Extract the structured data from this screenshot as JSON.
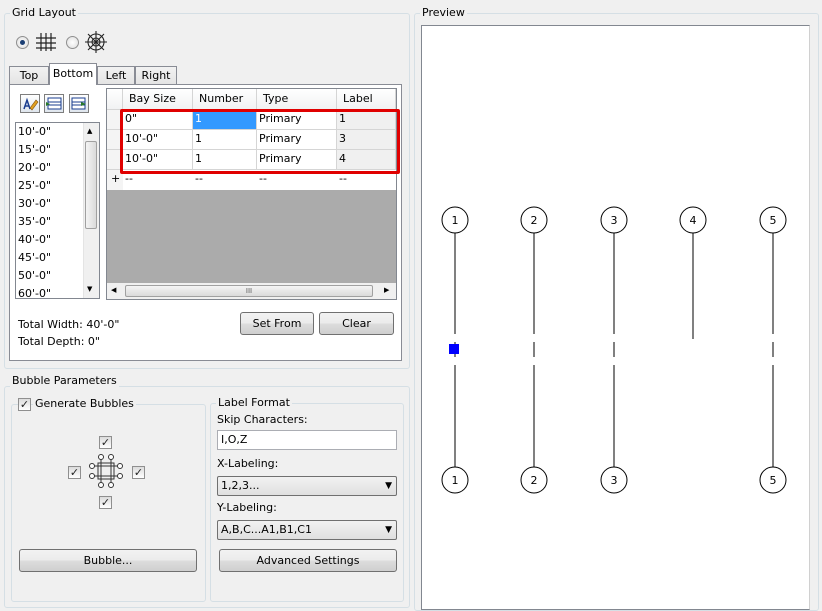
{
  "grid_layout": {
    "title": "Grid Layout",
    "mode_selected": "rectangular-grid",
    "tabs": [
      "Top",
      "Bottom",
      "Left",
      "Right"
    ],
    "active_tab": "Bottom",
    "sizes": [
      "10'-0\"",
      "15'-0\"",
      "20'-0\"",
      "25'-0\"",
      "30'-0\"",
      "35'-0\"",
      "40'-0\"",
      "45'-0\"",
      "50'-0\"",
      "60'-0\""
    ],
    "table": {
      "headers": [
        "Bay Size",
        "Number",
        "Type",
        "Label"
      ],
      "rows": [
        [
          "0\"",
          "1",
          "Primary",
          "1"
        ],
        [
          "10'-0\"",
          "1",
          "Primary",
          "3"
        ],
        [
          "10'-0\"",
          "1",
          "Primary",
          "4"
        ]
      ],
      "new_row_marker": "+",
      "new_row": [
        "--",
        "--",
        "--",
        "--"
      ],
      "scroll_grip": "III",
      "highlight_color": "#e00000"
    },
    "total_width": "Total Width: 40'-0\"",
    "total_depth": "Total Depth: 0\"",
    "set_from_label": "Set From",
    "clear_label": "Clear"
  },
  "bubble_parameters": {
    "title": "Bubble Parameters",
    "generate_bubbles_label": "Generate Bubbles",
    "generate_bubbles_checked": true,
    "sides_checked": {
      "top": true,
      "left": true,
      "right": true,
      "bottom": true
    },
    "bubble_button_label": "Bubble...",
    "label_format": {
      "title": "Label Format",
      "skip_characters_label": "Skip Characters:",
      "skip_characters_value": "I,O,Z",
      "x_labeling_label": "X-Labeling:",
      "x_labeling_value": "1,2,3...",
      "y_labeling_label": "Y-Labeling:",
      "y_labeling_value": "A,B,C...A1,B1,C1",
      "advanced_settings_label": "Advanced Settings"
    }
  },
  "preview": {
    "title": "Preview",
    "top_bubbles": [
      "1",
      "2",
      "3",
      "4",
      "5"
    ],
    "bottom_bubbles": [
      "1",
      "2",
      "3",
      "5"
    ],
    "selected_marker_color": "#0000ff"
  }
}
